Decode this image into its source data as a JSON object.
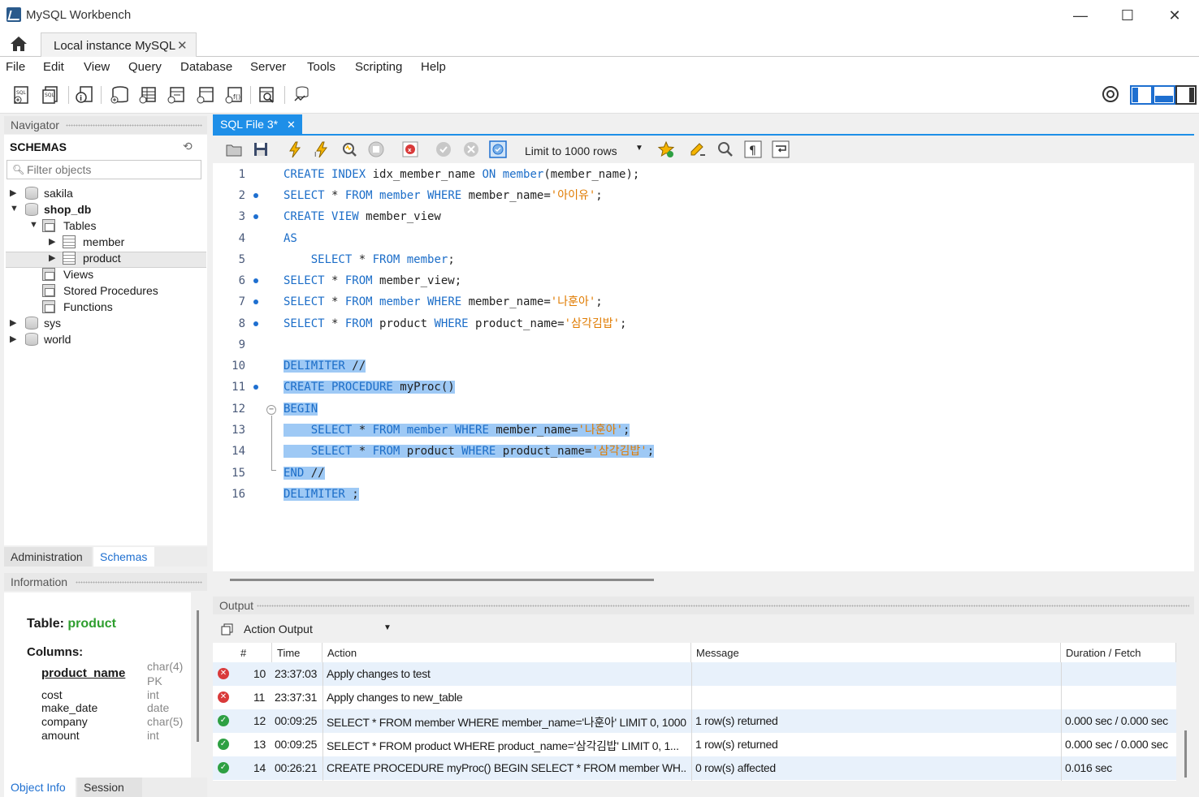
{
  "window": {
    "title": "MySQL Workbench"
  },
  "connection_tab": {
    "label": "Local instance MySQL"
  },
  "menu": [
    "File",
    "Edit",
    "View",
    "Query",
    "Database",
    "Server",
    "Tools",
    "Scripting",
    "Help"
  ],
  "navigator": {
    "title": "Navigator",
    "schemas_label": "SCHEMAS",
    "filter_placeholder": "Filter objects",
    "tree": [
      {
        "label": "sakila"
      },
      {
        "label": "shop_db"
      },
      {
        "label": "Tables"
      },
      {
        "label": "member"
      },
      {
        "label": "product"
      },
      {
        "label": "Views"
      },
      {
        "label": "Stored Procedures"
      },
      {
        "label": "Functions"
      },
      {
        "label": "sys"
      },
      {
        "label": "world"
      }
    ],
    "tabs": [
      "Administration",
      "Schemas"
    ]
  },
  "information": {
    "title": "Information",
    "table_label": "Table:",
    "table_name": "product",
    "columns_label": "Columns:",
    "columns": [
      {
        "name": "product_name",
        "type": "char(4)",
        "extra": "PK"
      },
      {
        "name": "cost",
        "type": "int"
      },
      {
        "name": "make_date",
        "type": "date"
      },
      {
        "name": "company",
        "type": "char(5)"
      },
      {
        "name": "amount",
        "type": "int"
      }
    ],
    "tabs": [
      "Object Info",
      "Session"
    ]
  },
  "editor": {
    "tab_label": "SQL File 3*",
    "limit_label": "Limit to 1000 rows",
    "lines": [
      {
        "n": "1"
      },
      {
        "n": "2"
      },
      {
        "n": "3"
      },
      {
        "n": "4"
      },
      {
        "n": "5"
      },
      {
        "n": "6"
      },
      {
        "n": "7"
      },
      {
        "n": "8"
      },
      {
        "n": "9"
      },
      {
        "n": "10"
      },
      {
        "n": "11"
      },
      {
        "n": "12"
      },
      {
        "n": "13"
      },
      {
        "n": "14"
      },
      {
        "n": "15"
      },
      {
        "n": "16"
      }
    ]
  },
  "output": {
    "title": "Output",
    "selector": "Action Output",
    "columns": [
      "#",
      "Time",
      "Action",
      "Message",
      "Duration / Fetch"
    ],
    "rows": [
      {
        "status": "error",
        "num": "10",
        "time": "23:37:03",
        "action": "Apply changes to test",
        "message": "",
        "duration": ""
      },
      {
        "status": "error",
        "num": "11",
        "time": "23:37:31",
        "action": "Apply changes to new_table",
        "message": "",
        "duration": ""
      },
      {
        "status": "ok",
        "num": "12",
        "time": "00:09:25",
        "action": "SELECT * FROM member WHERE member_name='나훈아' LIMIT 0, 1000",
        "message": "1 row(s) returned",
        "duration": "0.000 sec / 0.000 sec"
      },
      {
        "status": "ok",
        "num": "13",
        "time": "00:09:25",
        "action": "SELECT * FROM product WHERE product_name='삼각김밥' LIMIT 0, 1...",
        "message": "1 row(s) returned",
        "duration": "0.000 sec / 0.000 sec"
      },
      {
        "status": "ok",
        "num": "14",
        "time": "00:26:21",
        "action": "CREATE PROCEDURE myProc() BEGIN SELECT * FROM member WH...",
        "message": "0 row(s) affected",
        "duration": "0.016 sec"
      }
    ]
  }
}
